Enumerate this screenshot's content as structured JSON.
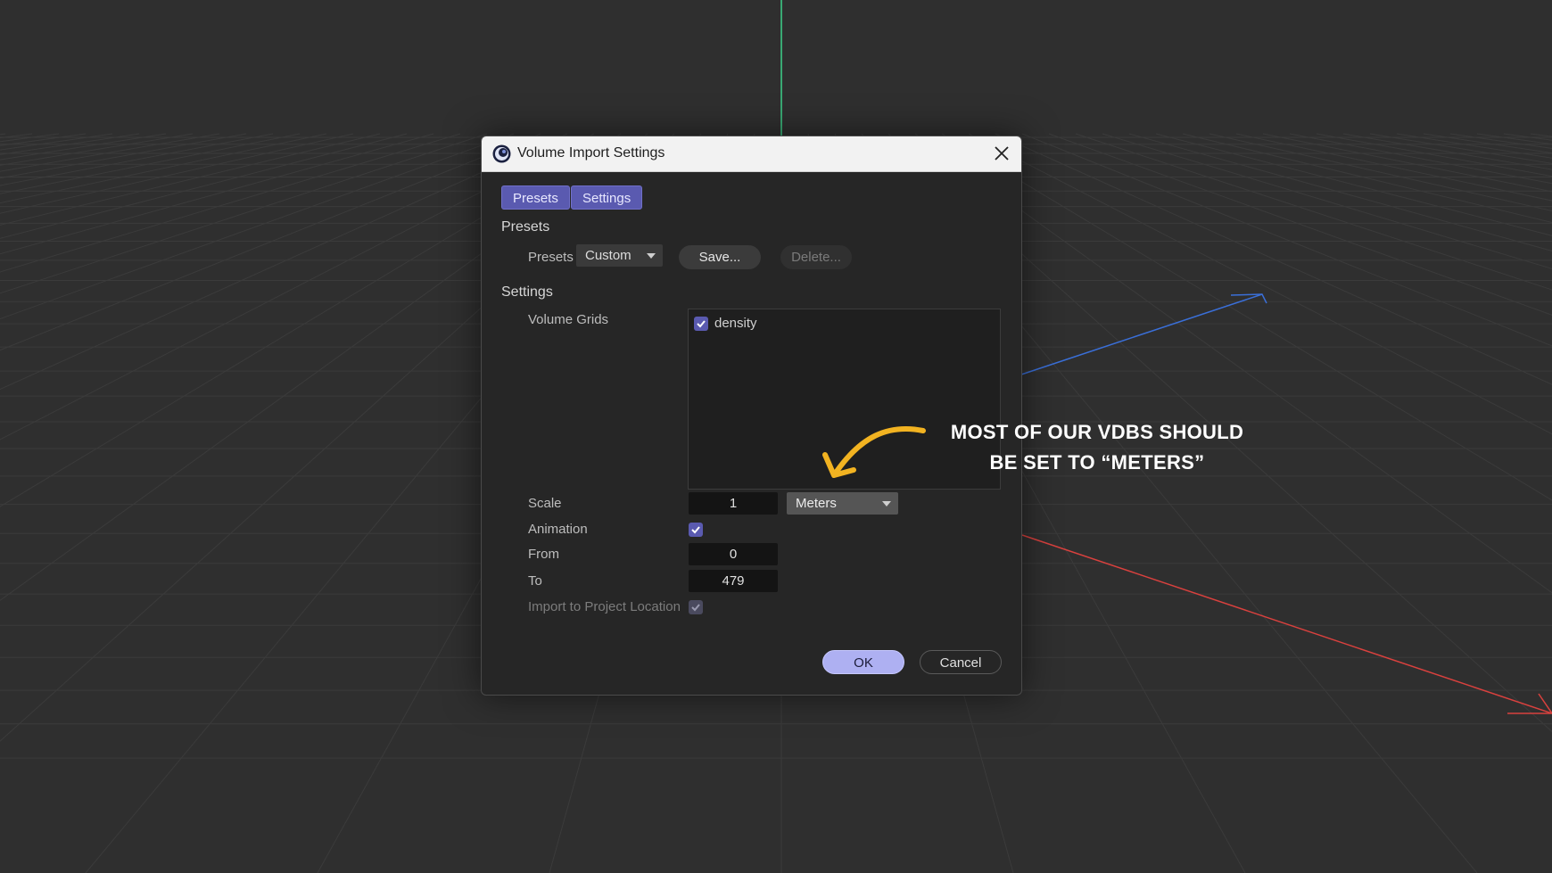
{
  "dialog": {
    "title": "Volume Import Settings",
    "tabs": [
      {
        "label": "Presets",
        "active": true
      },
      {
        "label": "Settings",
        "active": true
      }
    ],
    "presets_section": {
      "title": "Presets",
      "label": "Presets",
      "selected": "Custom",
      "save_label": "Save...",
      "delete_label": "Delete..."
    },
    "settings_section": {
      "title": "Settings",
      "volume_grids_label": "Volume Grids",
      "grids": [
        {
          "name": "density",
          "checked": true
        }
      ],
      "scale_label": "Scale",
      "scale_value": "1",
      "scale_unit": "Meters",
      "animation_label": "Animation",
      "animation_checked": true,
      "from_label": "From",
      "from_value": "0",
      "to_label": "To",
      "to_value": "479",
      "import_location_label": "Import to Project Location",
      "import_location_checked": true
    },
    "ok_label": "OK",
    "cancel_label": "Cancel"
  },
  "annotation": {
    "line1": "MOST OF OUR VDBS SHOULD",
    "line2": "BE SET TO “METERS”",
    "arrow_color": "#f2b321"
  },
  "colors": {
    "accent": "#5a5ab0",
    "ok_button": "#aeb0f2",
    "axis_x": "#d9413e",
    "axis_y": "#3dd08a",
    "axis_z": "#3a6fd8"
  }
}
